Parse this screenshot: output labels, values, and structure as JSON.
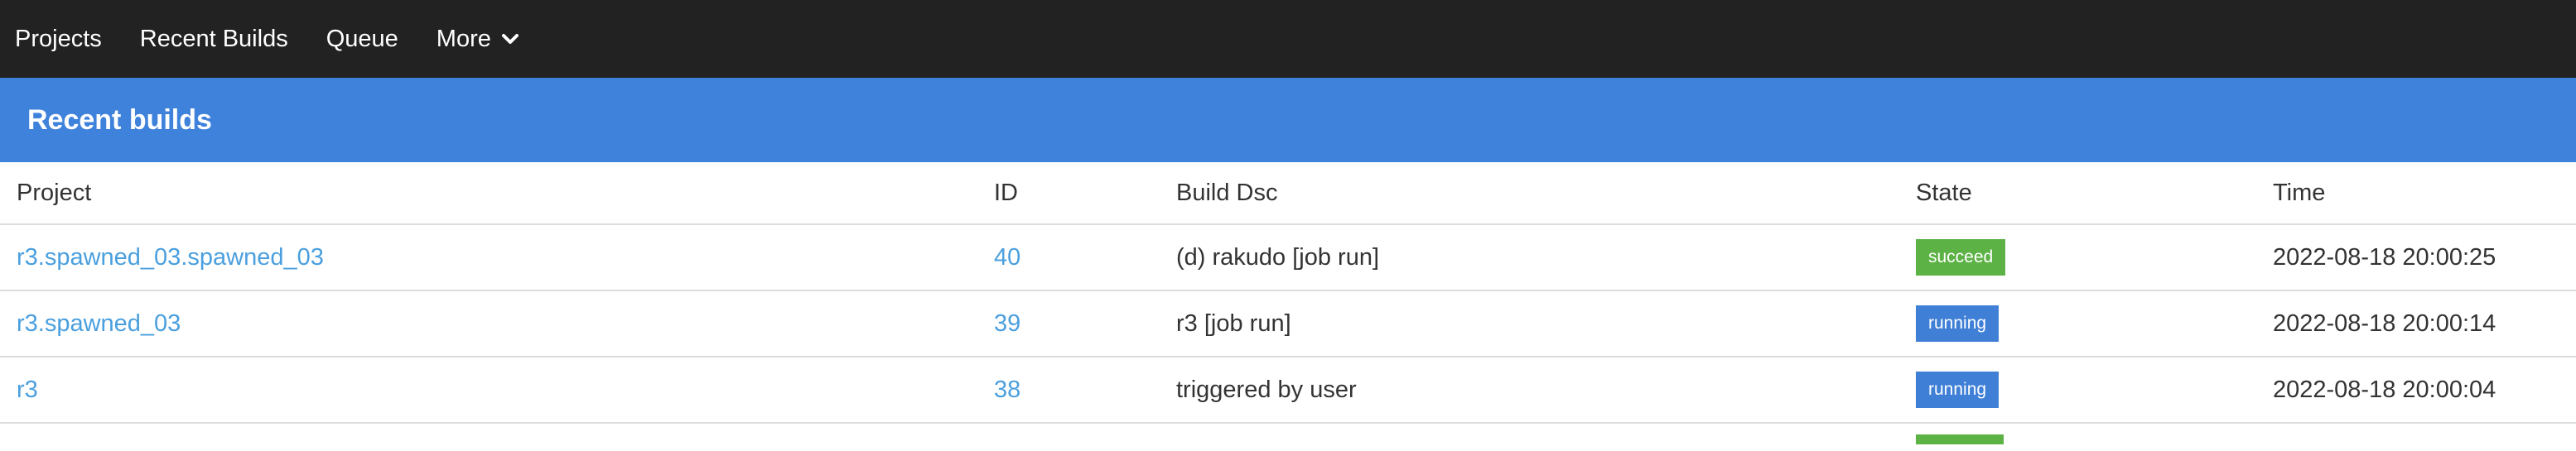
{
  "nav": {
    "items": [
      "Projects",
      "Recent Builds",
      "Queue"
    ],
    "more_label": "More"
  },
  "header": {
    "title": "Recent builds"
  },
  "table": {
    "columns": [
      "Project",
      "ID",
      "Build Dsc",
      "State",
      "Time"
    ],
    "rows": [
      {
        "project": "r3.spawned_03.spawned_03",
        "id": "40",
        "desc": "(d) rakudo [job run]",
        "state": "succeed",
        "time": "2022-08-18 20:00:25"
      },
      {
        "project": "r3.spawned_03",
        "id": "39",
        "desc": "r3 [job run]",
        "state": "running",
        "time": "2022-08-18 20:00:14"
      },
      {
        "project": "r3",
        "id": "38",
        "desc": "triggered by user",
        "state": "running",
        "time": "2022-08-18 20:00:04"
      }
    ]
  },
  "colors": {
    "nav_bg": "#222222",
    "header_bg": "#3f82dc",
    "link": "#4a9fde",
    "succeed": "#5db246",
    "running": "#3f7fd6"
  }
}
